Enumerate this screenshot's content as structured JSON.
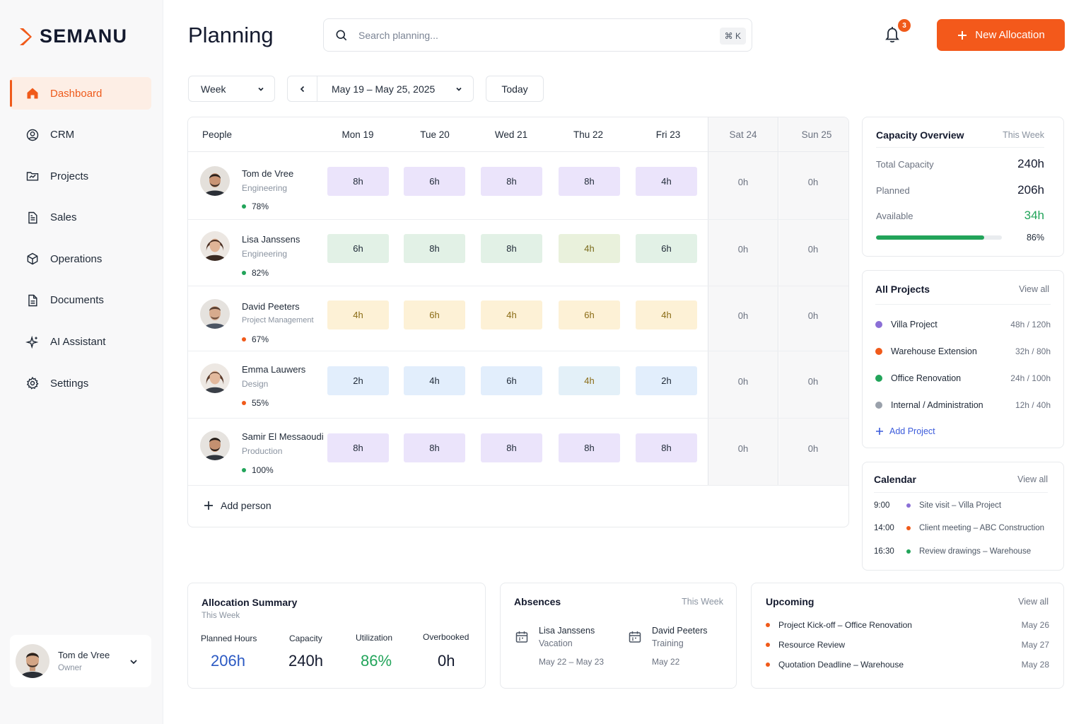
{
  "brand": {
    "name": "SEMANU",
    "accent": "#f3591b"
  },
  "sidebar": {
    "items": [
      {
        "label": "Dashboard",
        "icon": "home-icon",
        "active": true
      },
      {
        "label": "CRM",
        "icon": "user-circle-icon"
      },
      {
        "label": "Projects",
        "icon": "folder-chart-icon"
      },
      {
        "label": "Sales",
        "icon": "document-icon"
      },
      {
        "label": "Operations",
        "icon": "cube-icon"
      },
      {
        "label": "Documents",
        "icon": "file-text-icon"
      },
      {
        "label": "AI Assistant",
        "icon": "sparkle-icon"
      },
      {
        "label": "Settings",
        "icon": "gear-icon"
      }
    ],
    "user": {
      "name": "Tom de Vree",
      "role": "Owner"
    }
  },
  "header": {
    "title": "Planning",
    "search_placeholder": "Search planning...",
    "shortcut": "⌘ K",
    "notifications": "3",
    "new_button": "New Allocation"
  },
  "toolbar": {
    "view": "Week",
    "range": "May 19 – May 25, 2025",
    "today": "Today"
  },
  "grid": {
    "people_header": "People",
    "days": [
      "Mon 19",
      "Tue 20",
      "Wed 21",
      "Thu 22",
      "Fri 23",
      "Sat 24",
      "Sun 25"
    ],
    "people": [
      {
        "name": "Tom de Vree",
        "dept": "Engineering",
        "util": "78%",
        "util_color": "#22a45a",
        "color": "purple",
        "hours": [
          "8h",
          "6h",
          "8h",
          "8h",
          "4h",
          "0h",
          "0h"
        ]
      },
      {
        "name": "Lisa Janssens",
        "dept": "Engineering",
        "util": "82%",
        "util_color": "#22a45a",
        "color": "green",
        "hours": [
          "6h",
          "8h",
          "8h",
          "4h",
          "6h",
          "0h",
          "0h"
        ]
      },
      {
        "name": "David Peeters",
        "dept": "Project Management",
        "util": "67%",
        "util_color": "#f05a1a",
        "color": "yellow",
        "hours": [
          "4h",
          "6h",
          "4h",
          "6h",
          "4h",
          "0h",
          "0h"
        ]
      },
      {
        "name": "Emma Lauwers",
        "dept": "Design",
        "util": "55%",
        "util_color": "#f05a1a",
        "color": "blue",
        "hours": [
          "2h",
          "4h",
          "6h",
          "4h",
          "2h",
          "0h",
          "0h"
        ]
      },
      {
        "name": "Samir El Messaoudi",
        "dept": "Production",
        "util": "100%",
        "util_color": "#22a45a",
        "color": "purple",
        "hours": [
          "8h",
          "8h",
          "8h",
          "8h",
          "8h",
          "0h",
          "0h"
        ]
      }
    ],
    "add_person": "Add person"
  },
  "capacity": {
    "title": "Capacity Overview",
    "period": "This Week",
    "total_label": "Total Capacity",
    "total": "240h",
    "planned_label": "Planned",
    "planned": "206h",
    "available_label": "Available",
    "available": "34h",
    "percent_label": "86%",
    "fill_fraction": 0.86
  },
  "projects": {
    "title": "All Projects",
    "view_all": "View all",
    "items": [
      {
        "name": "Villa Project",
        "hours": "48h / 120h",
        "color": "#8b6fd6"
      },
      {
        "name": "Warehouse Extension",
        "hours": "32h / 80h",
        "color": "#f05a1a"
      },
      {
        "name": "Office Renovation",
        "hours": "24h / 100h",
        "color": "#22a45a"
      },
      {
        "name": "Internal / Administration",
        "hours": "12h / 40h",
        "color": "#9aa1ab"
      }
    ],
    "add": "Add Project"
  },
  "calendar": {
    "title": "Calendar",
    "view_all": "View all",
    "events": [
      {
        "time": "9:00",
        "text": "Site visit – Villa Project",
        "color": "#8b6fd6"
      },
      {
        "time": "14:00",
        "text": "Client meeting – ABC Construction",
        "color": "#f05a1a"
      },
      {
        "time": "16:30",
        "text": "Review drawings – Warehouse",
        "color": "#22a45a"
      }
    ]
  },
  "summary": {
    "title": "Allocation Summary",
    "period": "This Week",
    "stats": [
      {
        "label": "Planned Hours",
        "value": "206h"
      },
      {
        "label": "Capacity",
        "value": "240h"
      },
      {
        "label": "Utilization",
        "value": "86%"
      },
      {
        "label": "Overbooked",
        "value": "0h"
      }
    ]
  },
  "absences": {
    "title": "Absences",
    "period": "This Week",
    "items": [
      {
        "name": "Lisa Janssens",
        "type": "Vacation",
        "date": "May 22 – May 23"
      },
      {
        "name": "David Peeters",
        "type": "Training",
        "date": "May 22"
      }
    ]
  },
  "upcoming": {
    "title": "Upcoming",
    "view_all": "View all",
    "items": [
      {
        "text": "Project Kick-off – Office Renovation",
        "date": "May 26"
      },
      {
        "text": "Resource Review",
        "date": "May 27"
      },
      {
        "text": "Quotation Deadline – Warehouse",
        "date": "May 28"
      }
    ]
  }
}
